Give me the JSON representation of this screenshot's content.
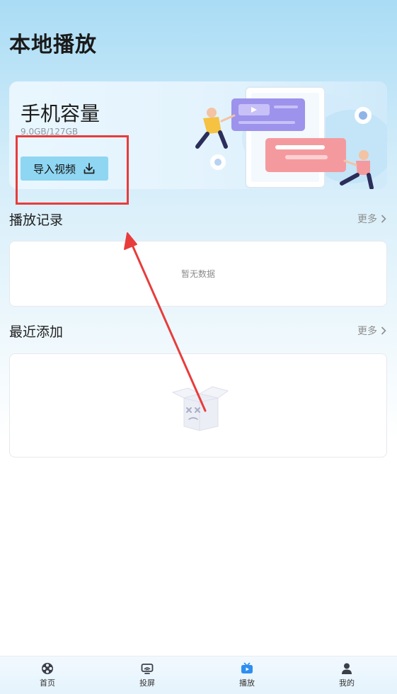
{
  "page": {
    "title": "本地播放"
  },
  "storage": {
    "title": "手机容量",
    "usage": "9.0GB/127GB",
    "import_label": "导入视频"
  },
  "history": {
    "title": "播放记录",
    "more_label": "更多",
    "empty_text": "暂无数据"
  },
  "recent": {
    "title": "最近添加",
    "more_label": "更多"
  },
  "tabs": [
    {
      "label": "首页",
      "icon": "film-reel-icon",
      "active": false
    },
    {
      "label": "投屏",
      "icon": "screencast-icon",
      "active": false
    },
    {
      "label": "播放",
      "icon": "tv-play-icon",
      "active": true
    },
    {
      "label": "我的",
      "icon": "user-icon",
      "active": false
    }
  ],
  "colors": {
    "accent": "#2f8ff0",
    "import_button": "#8fd6f2",
    "highlight_red": "#e83c3c"
  }
}
